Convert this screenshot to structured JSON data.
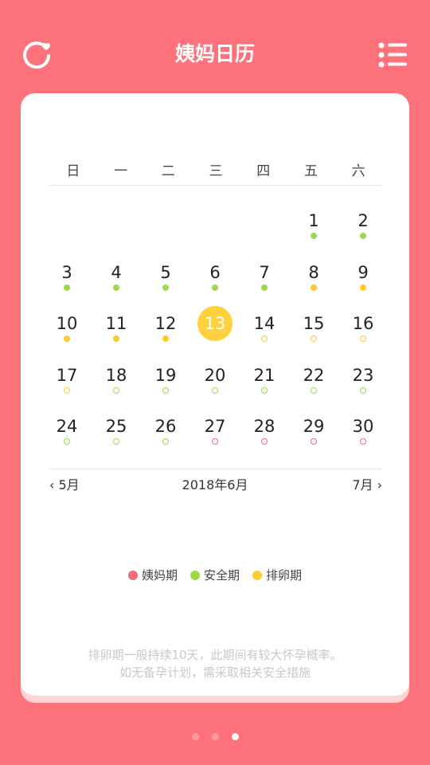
{
  "header": {
    "title": "姨妈日历",
    "left_icon": "refresh-heart-icon",
    "right_icon": "list-menu-icon"
  },
  "colors": {
    "background": "#fe727b",
    "period": "#f36b7e",
    "safe": "#9ed84d",
    "ovulation": "#fdcb2e",
    "today": "#fed13d"
  },
  "calendar": {
    "weekdays": [
      "日",
      "一",
      "二",
      "三",
      "四",
      "五",
      "六"
    ],
    "month_label": "2018年6月",
    "prev_label": "5月",
    "next_label": "7月",
    "days": [
      {
        "day": "1",
        "col": 5,
        "row": 0,
        "type": "safe",
        "fill": "solid"
      },
      {
        "day": "2",
        "col": 6,
        "row": 0,
        "type": "safe",
        "fill": "solid"
      },
      {
        "day": "3",
        "col": 0,
        "row": 1,
        "type": "safe",
        "fill": "solid"
      },
      {
        "day": "4",
        "col": 1,
        "row": 1,
        "type": "safe",
        "fill": "solid"
      },
      {
        "day": "5",
        "col": 2,
        "row": 1,
        "type": "safe",
        "fill": "solid"
      },
      {
        "day": "6",
        "col": 3,
        "row": 1,
        "type": "safe",
        "fill": "solid"
      },
      {
        "day": "7",
        "col": 4,
        "row": 1,
        "type": "safe",
        "fill": "solid"
      },
      {
        "day": "8",
        "col": 5,
        "row": 1,
        "type": "ovulation",
        "fill": "solid"
      },
      {
        "day": "9",
        "col": 6,
        "row": 1,
        "type": "ovulation",
        "fill": "solid"
      },
      {
        "day": "10",
        "col": 0,
        "row": 2,
        "type": "ovulation",
        "fill": "solid"
      },
      {
        "day": "11",
        "col": 1,
        "row": 2,
        "type": "ovulation",
        "fill": "solid"
      },
      {
        "day": "12",
        "col": 2,
        "row": 2,
        "type": "ovulation",
        "fill": "solid"
      },
      {
        "day": "13",
        "col": 3,
        "row": 2,
        "type": "today",
        "fill": "none"
      },
      {
        "day": "14",
        "col": 4,
        "row": 2,
        "type": "ovulation",
        "fill": "outline"
      },
      {
        "day": "15",
        "col": 5,
        "row": 2,
        "type": "ovulation",
        "fill": "outline"
      },
      {
        "day": "16",
        "col": 6,
        "row": 2,
        "type": "ovulation",
        "fill": "outline"
      },
      {
        "day": "17",
        "col": 0,
        "row": 3,
        "type": "ovulation",
        "fill": "outline"
      },
      {
        "day": "18",
        "col": 1,
        "row": 3,
        "type": "safe",
        "fill": "outline"
      },
      {
        "day": "19",
        "col": 2,
        "row": 3,
        "type": "safe",
        "fill": "outline"
      },
      {
        "day": "20",
        "col": 3,
        "row": 3,
        "type": "safe",
        "fill": "outline"
      },
      {
        "day": "21",
        "col": 4,
        "row": 3,
        "type": "safe",
        "fill": "outline"
      },
      {
        "day": "22",
        "col": 5,
        "row": 3,
        "type": "safe",
        "fill": "outline"
      },
      {
        "day": "23",
        "col": 6,
        "row": 3,
        "type": "safe",
        "fill": "outline"
      },
      {
        "day": "24",
        "col": 0,
        "row": 4,
        "type": "safe",
        "fill": "outline"
      },
      {
        "day": "25",
        "col": 1,
        "row": 4,
        "type": "safe",
        "fill": "outline"
      },
      {
        "day": "26",
        "col": 2,
        "row": 4,
        "type": "safe",
        "fill": "outline"
      },
      {
        "day": "27",
        "col": 3,
        "row": 4,
        "type": "period",
        "fill": "outline"
      },
      {
        "day": "28",
        "col": 4,
        "row": 4,
        "type": "period",
        "fill": "outline"
      },
      {
        "day": "29",
        "col": 5,
        "row": 4,
        "type": "period",
        "fill": "outline"
      },
      {
        "day": "30",
        "col": 6,
        "row": 4,
        "type": "period",
        "fill": "outline"
      }
    ]
  },
  "legend": [
    {
      "label": "姨妈期",
      "type": "period"
    },
    {
      "label": "安全期",
      "type": "safe"
    },
    {
      "label": "排卵期",
      "type": "ovulation"
    }
  ],
  "note": {
    "line1": "排卵期一般持续10天，此期间有较大怀孕概率。",
    "line2": "如无备孕计划，需采取相关安全措施"
  },
  "pager": {
    "count": 3,
    "active": 2
  }
}
